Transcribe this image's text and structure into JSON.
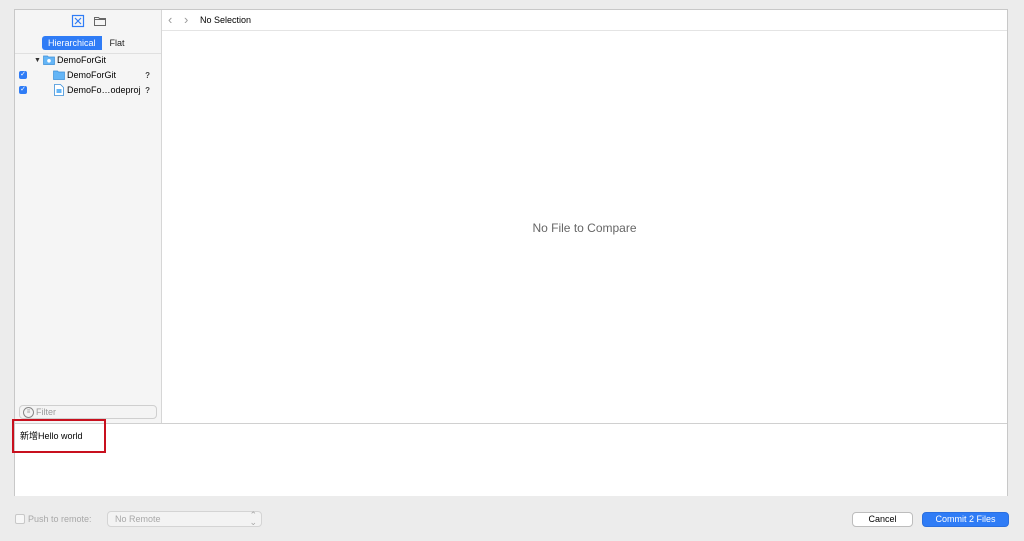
{
  "sidebar": {
    "view_toggle": {
      "hierarchical": "Hierarchical",
      "flat": "Flat"
    },
    "tree": [
      {
        "label": "DemoForGit",
        "checked": false,
        "expanded": true,
        "status": ""
      },
      {
        "label": "DemoForGit",
        "checked": true,
        "status": "?"
      },
      {
        "label": "DemoFo…odeproj",
        "checked": true,
        "status": "?"
      }
    ],
    "filter_placeholder": "Filter"
  },
  "pathbar": {
    "title": "No Selection"
  },
  "content": {
    "empty_message": "No File to Compare"
  },
  "commit_message": "新增Hello world",
  "bottom": {
    "push_label": "Push to remote:",
    "remote_select": "No Remote",
    "cancel_label": "Cancel",
    "commit_label": "Commit 2 Files"
  },
  "colors": {
    "accent": "#2f7cf6",
    "highlight": "#c8101e"
  }
}
